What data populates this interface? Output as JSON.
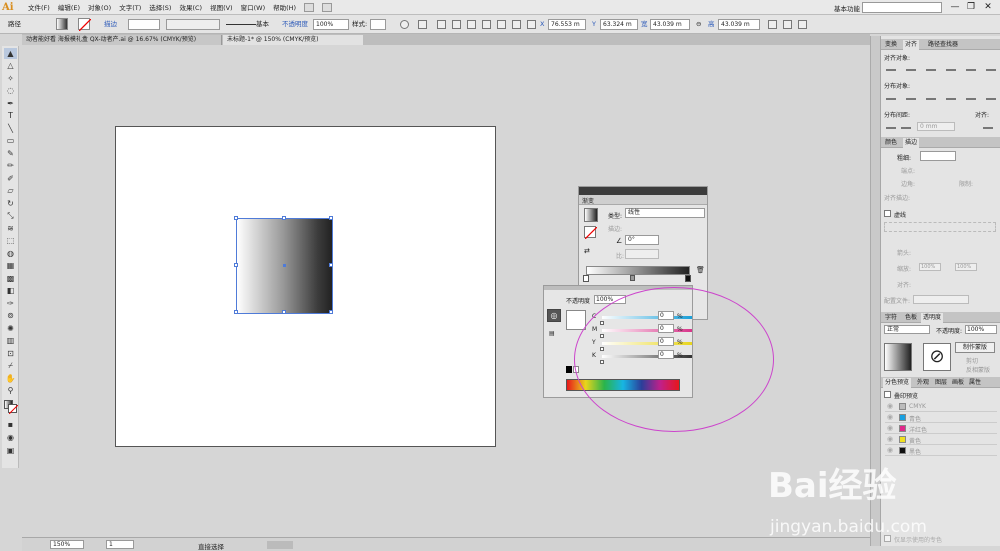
{
  "app": {
    "logo": "Ai"
  },
  "menu": {
    "items": [
      "文件(F)",
      "编辑(E)",
      "对象(O)",
      "文字(T)",
      "选择(S)",
      "效果(C)",
      "视图(V)",
      "窗口(W)",
      "帮助(H)"
    ]
  },
  "workspace": {
    "label": "基本功能"
  },
  "window_controls": {
    "minimize": "—",
    "restore": "❐",
    "close": "✕"
  },
  "control_bar": {
    "selection_type": "路径",
    "stroke_label": "描边",
    "stroke_style": "基本",
    "opacity_label": "不透明度",
    "opacity_value": "100%",
    "style_label": "样式:",
    "x_label": "X",
    "x_value": "76.553 m",
    "y_label": "Y",
    "y_value": "63.324 m",
    "w_label": "宽",
    "w_value": "43.039 m",
    "h_label": "高",
    "h_value": "43.039 m"
  },
  "document_tabs": [
    {
      "label": "动者能好看 海报模礼盒 QX-动者产.ai @ 16.67% (CMYK/预览)",
      "active": false
    },
    {
      "label": "未标题-1* @ 150% (CMYK/预览)",
      "active": true
    }
  ],
  "gradient_panel": {
    "tab_label": "渐变",
    "type_label": "类型:",
    "type_value": "线性",
    "stroke_label": "描边:",
    "angle_value": "0°",
    "ratio_label": "比:",
    "stops": [
      "white",
      "black"
    ]
  },
  "color_panel": {
    "opacity_label": "不透明度",
    "opacity_value": "100%",
    "channels": [
      {
        "name": "C",
        "value": "0",
        "unit": "%",
        "color": "#1a9fd8"
      },
      {
        "name": "M",
        "value": "0",
        "unit": "%",
        "color": "#d8348a"
      },
      {
        "name": "Y",
        "value": "0",
        "unit": "%",
        "color": "#e8d51c"
      },
      {
        "name": "K",
        "value": "0",
        "unit": "%",
        "color": "#333333"
      }
    ]
  },
  "right_panels": {
    "align_tabs": [
      "变换",
      "对齐",
      "路径查找器"
    ],
    "align_objects_label": "对齐对象:",
    "distribute_objects_label": "分布对象:",
    "distribute_spacing_label": "分布间距:",
    "align_to_label": "对齐:",
    "spacing_value": "0 mm",
    "stroke_tabs": [
      "颜色",
      "描边"
    ],
    "weight_label": "粗细:",
    "cap_label": "端点:",
    "corner_label": "边角:",
    "limit_label": "限制:",
    "align_stroke_label": "对齐描边:",
    "dashed_label": "虚线",
    "arrow_label": "箭头:",
    "scale_label": "缩放:",
    "scale_value1": "100%",
    "scale_value2": "100%",
    "align_label": "对齐:",
    "profile_label": "配置文件:",
    "trans_tabs": [
      "字符",
      "色板",
      "透明度"
    ],
    "blend_mode": "正常",
    "trans_opacity_label": "不透明度:",
    "trans_opacity_value": "100%",
    "make_mask_label": "制作蒙版",
    "clip_label": "剪切",
    "invert_mask_label": "反相蒙版",
    "sep_tabs": [
      "分色预览",
      "外观",
      "图层",
      "画板",
      "属性"
    ],
    "overprint_label": "叠印预览",
    "separations": [
      {
        "name": "CMYK",
        "color": "#bbbbbb"
      },
      {
        "name": "青色",
        "color": "#1aa0e0"
      },
      {
        "name": "洋红色",
        "color": "#e0288a"
      },
      {
        "name": "黄色",
        "color": "#f0e020"
      },
      {
        "name": "黑色",
        "color": "#111111"
      }
    ],
    "show_used_label": "仅显示使用的专色"
  },
  "status_bar": {
    "zoom": "150%",
    "page": "1",
    "tool": "直接选择"
  },
  "watermark": {
    "brand": "Bai经验",
    "url": "jingyan.baidu.com"
  }
}
